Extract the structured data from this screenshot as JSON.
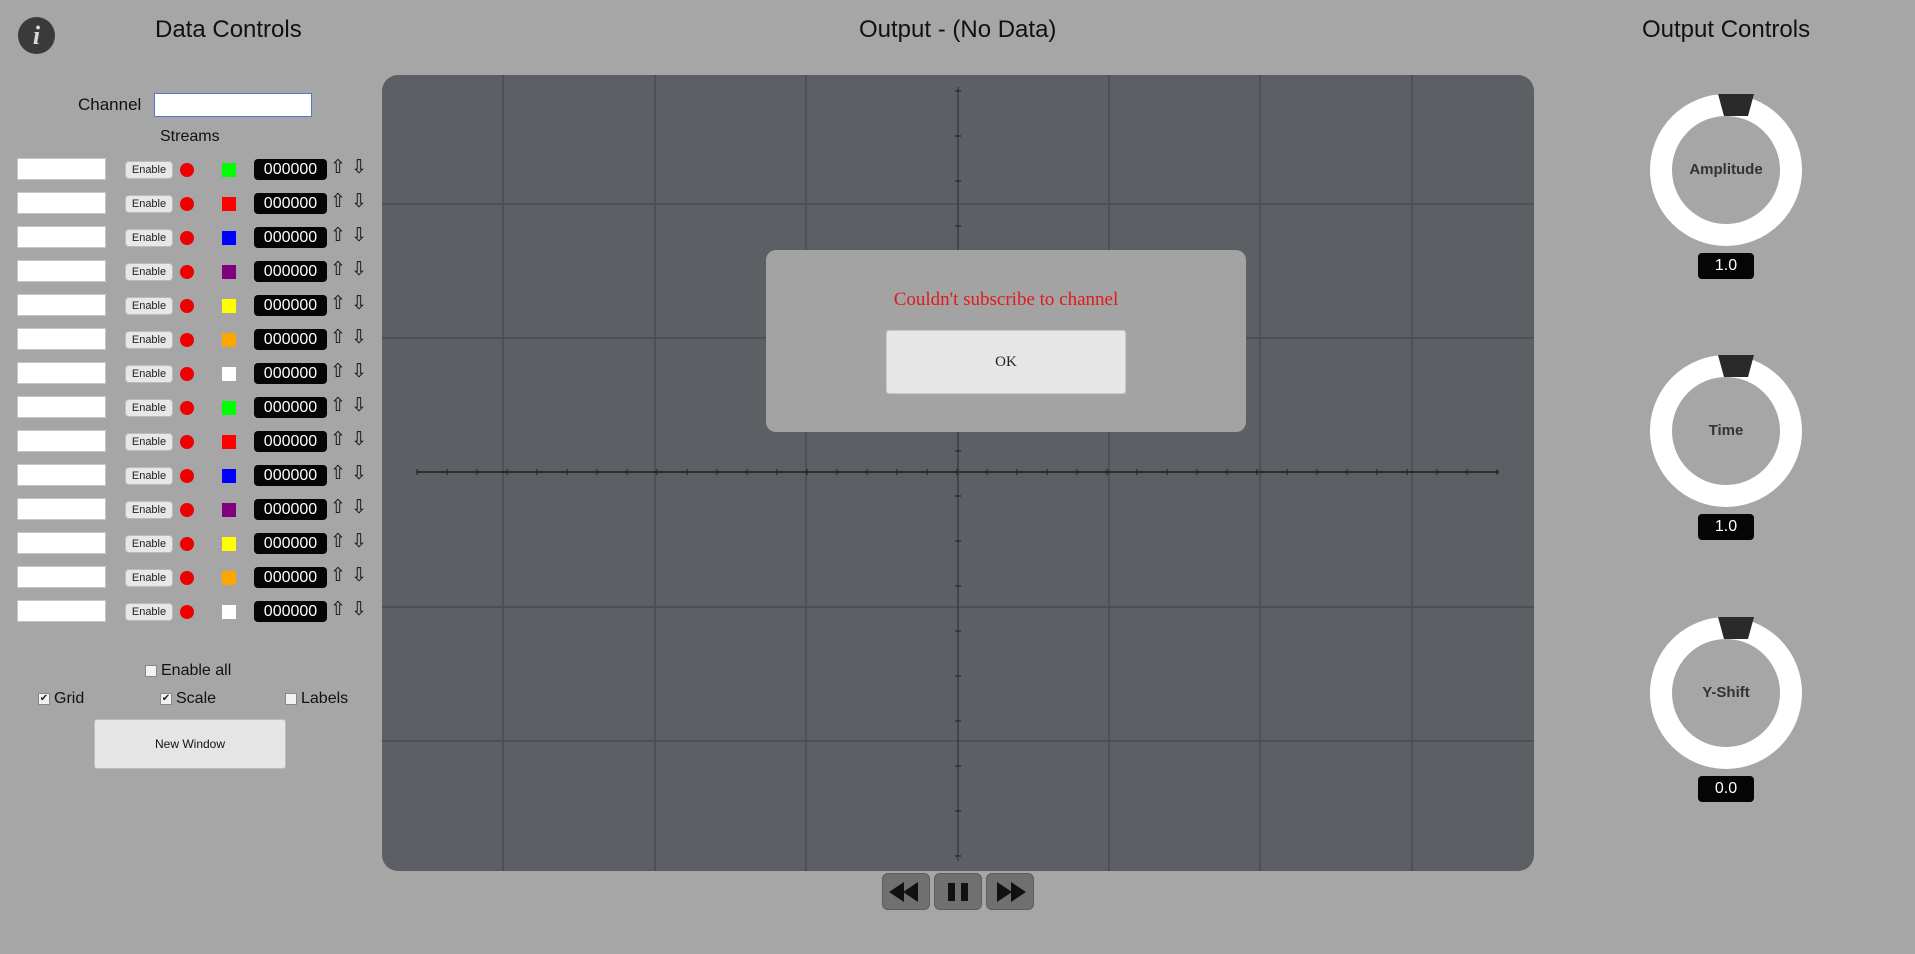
{
  "header": {
    "data_controls_title": "Data Controls",
    "output_title": "Output - (No Data)",
    "output_controls_title": "Output Controls"
  },
  "channel": {
    "label": "Channel",
    "value": ""
  },
  "streams": {
    "label": "Streams",
    "items": [
      {
        "name": "",
        "enable_label": "Enable",
        "status_color": "#ee0000",
        "swatch_color": "#00ff00",
        "value": "000000"
      },
      {
        "name": "",
        "enable_label": "Enable",
        "status_color": "#ee0000",
        "swatch_color": "#ff0000",
        "value": "000000"
      },
      {
        "name": "",
        "enable_label": "Enable",
        "status_color": "#ee0000",
        "swatch_color": "#0000ff",
        "value": "000000"
      },
      {
        "name": "",
        "enable_label": "Enable",
        "status_color": "#ee0000",
        "swatch_color": "#800080",
        "value": "000000"
      },
      {
        "name": "",
        "enable_label": "Enable",
        "status_color": "#ee0000",
        "swatch_color": "#ffff00",
        "value": "000000"
      },
      {
        "name": "",
        "enable_label": "Enable",
        "status_color": "#ee0000",
        "swatch_color": "#ffa500",
        "value": "000000"
      },
      {
        "name": "",
        "enable_label": "Enable",
        "status_color": "#ee0000",
        "swatch_color": "#ffffff",
        "value": "000000"
      },
      {
        "name": "",
        "enable_label": "Enable",
        "status_color": "#ee0000",
        "swatch_color": "#00ff00",
        "value": "000000"
      },
      {
        "name": "",
        "enable_label": "Enable",
        "status_color": "#ee0000",
        "swatch_color": "#ff0000",
        "value": "000000"
      },
      {
        "name": "",
        "enable_label": "Enable",
        "status_color": "#ee0000",
        "swatch_color": "#0000ff",
        "value": "000000"
      },
      {
        "name": "",
        "enable_label": "Enable",
        "status_color": "#ee0000",
        "swatch_color": "#800080",
        "value": "000000"
      },
      {
        "name": "",
        "enable_label": "Enable",
        "status_color": "#ee0000",
        "swatch_color": "#ffff00",
        "value": "000000"
      },
      {
        "name": "",
        "enable_label": "Enable",
        "status_color": "#ee0000",
        "swatch_color": "#ffa500",
        "value": "000000"
      },
      {
        "name": "",
        "enable_label": "Enable",
        "status_color": "#ee0000",
        "swatch_color": "#ffffff",
        "value": "000000"
      }
    ],
    "up_icon": "arrow-up-icon",
    "down_icon": "arrow-down-icon"
  },
  "options": {
    "enable_all": {
      "label": "Enable all",
      "checked": false
    },
    "grid": {
      "label": "Grid",
      "checked": true
    },
    "scale": {
      "label": "Scale",
      "checked": true
    },
    "labels": {
      "label": "Labels",
      "checked": false
    }
  },
  "new_window_label": "New Window",
  "dialog": {
    "message": "Couldn't subscribe to channel",
    "ok_label": "OK"
  },
  "playback": {
    "icons": [
      "rewind-icon",
      "pause-icon",
      "fast-forward-icon"
    ]
  },
  "knobs": [
    {
      "label": "Amplitude",
      "value": "1.0"
    },
    {
      "label": "Time",
      "value": "1.0"
    },
    {
      "label": "Y-Shift",
      "value": "0.0"
    }
  ],
  "colors": {
    "background": "#a6a6a6",
    "plot_background": "#5c5f64",
    "error_text": "#e01b1b"
  }
}
